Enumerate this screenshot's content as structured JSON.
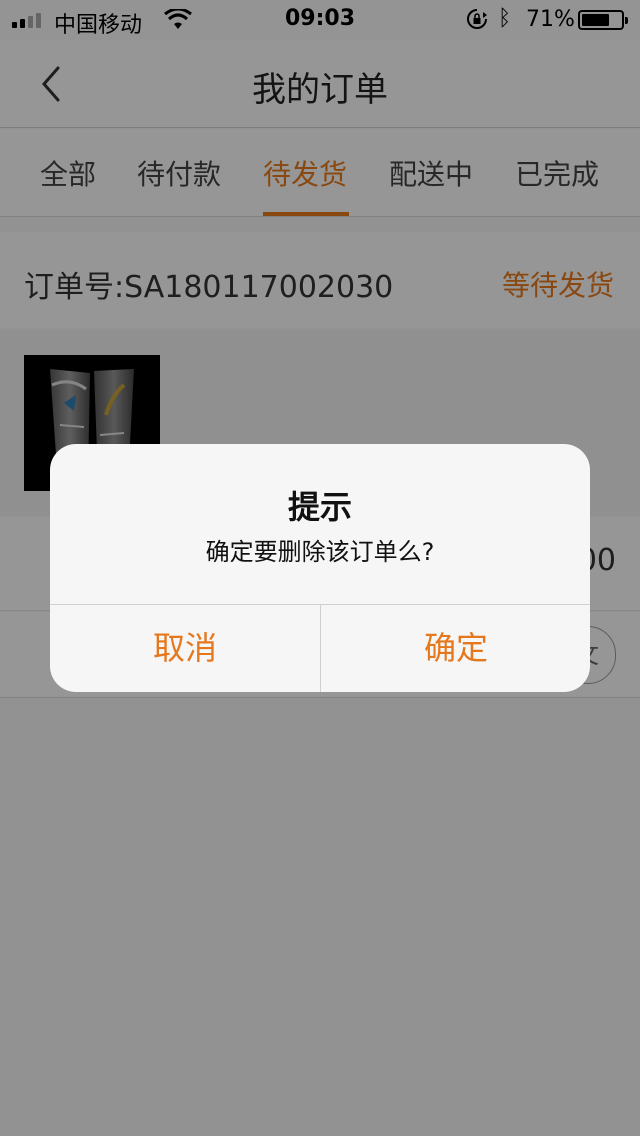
{
  "status_bar": {
    "carrier": "中国移动",
    "time": "09:03",
    "battery_percent": "71%",
    "battery_level": 0.71,
    "icons": [
      "signal-icon",
      "wifi-icon",
      "rotation-lock-icon",
      "bluetooth-icon",
      "battery-icon"
    ]
  },
  "nav": {
    "title": "我的订单",
    "back_icon": "chevron-left-icon"
  },
  "tabs": [
    {
      "label": "全部",
      "active": false
    },
    {
      "label": "待付款",
      "active": false
    },
    {
      "label": "待发货",
      "active": true
    },
    {
      "label": "配送中",
      "active": false
    },
    {
      "label": "已完成",
      "active": false
    }
  ],
  "order": {
    "number": "订单号:SA180117002030",
    "status": "等待发货",
    "price_tail": "00",
    "action_partial": "文"
  },
  "dialog": {
    "title": "提示",
    "message": "确定要删除该订单么?",
    "cancel_label": "取消",
    "confirm_label": "确定"
  },
  "colors": {
    "accent": "#e5781c",
    "overlay": "rgba(0,0,0,0.40)"
  }
}
